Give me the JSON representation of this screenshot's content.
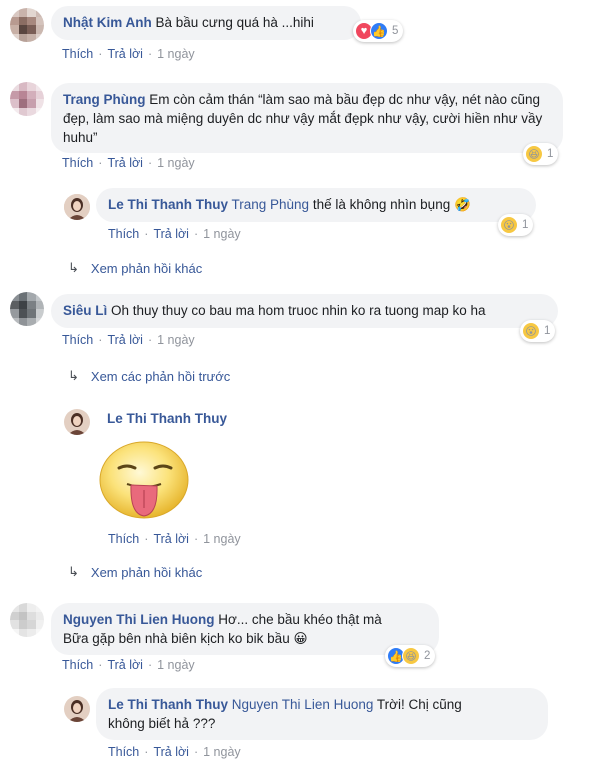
{
  "action_like": "Thích",
  "action_reply": "Trả lời",
  "time_1d": "1 ngày",
  "comments": [
    {
      "author": "Nhật Kim Anh",
      "text": "Bà bầu cưng quá hà ...hihi",
      "reaction_count": "5"
    },
    {
      "author": "Trang Phùng",
      "text": "Em còn cảm thán “làm sao mà bầu đẹp dc như vậy, nét nào cũng đẹp, làm sao mà miệng duyên dc như vậy mắt đẹpk như vậy, cười hiền như vầy huhu”",
      "reaction_count": "1"
    },
    {
      "author": "Le Thi Thanh Thuy",
      "mention": "Trang Phùng",
      "text": "thế là không nhìn bụng",
      "emoji": "🤣",
      "reaction_count": "1"
    },
    {
      "author": "Siêu Lì",
      "text": "Oh thuy thuy co bau ma hom truoc nhin ko ra tuong map ko ha",
      "reaction_count": "1"
    },
    {
      "author": "Le Thi Thanh Thuy",
      "sticker": "tongue-out-sticker"
    },
    {
      "author": "Nguyen Thi Lien Huong",
      "text_line1": "Hơ... che bầu khéo thật mà",
      "text_line2": "Bữa gặp bên nhà biên kịch ko bik bầu",
      "emoji": "😀",
      "reaction_count": "2"
    },
    {
      "author": "Le Thi Thanh Thuy",
      "mention": "Nguyen Thi Lien Huong",
      "text_line1": "Trời! Chị cũng",
      "text_line2": "không biết hả ???"
    }
  ],
  "more_replies_1": "Xem phản hồi khác",
  "prev_replies": "Xem các phản hồi trước",
  "more_replies_2": "Xem phản hồi khác",
  "colors": {
    "link": "#385898",
    "bubble": "#f2f3f5",
    "meta": "#90949c"
  }
}
